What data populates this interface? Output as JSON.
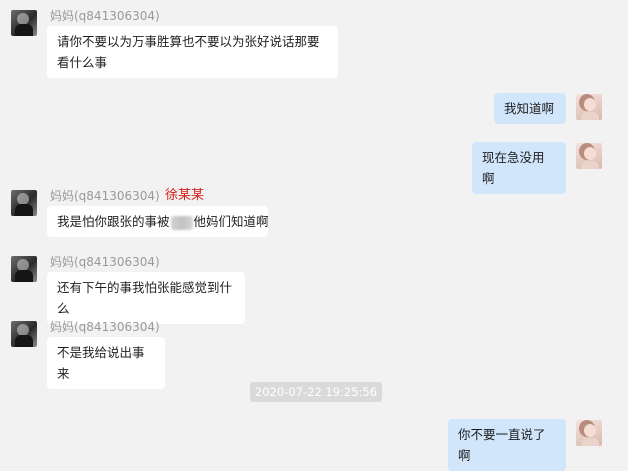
{
  "messages": [
    {
      "sender": "妈妈(q841306304)",
      "text": "请你不要以为万事胜算也不要以为张好说话那要看什么事"
    },
    {
      "text": "我知道啊"
    },
    {
      "text": "现在急没用啊"
    },
    {
      "sender": "妈妈(q841306304)",
      "text_before": "我是怕你跟张的事被",
      "text_after": "他妈们知道啊"
    },
    {
      "sender": "妈妈(q841306304)",
      "text": "还有下午的事我怕张能感觉到什么"
    },
    {
      "sender": "妈妈(q841306304)",
      "text": "不是我给说出事来"
    },
    {
      "text": "你不要一直说了啊"
    }
  ],
  "annotation": "徐某某",
  "timestamp": "2020-07-22 19:25:56"
}
